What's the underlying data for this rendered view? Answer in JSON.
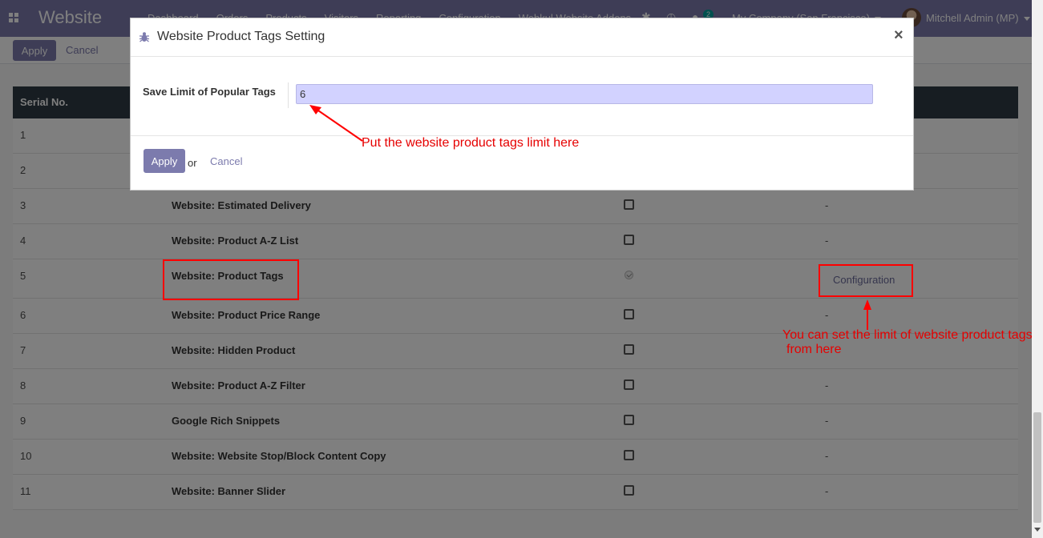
{
  "navbar": {
    "brand": "Website",
    "menu": [
      "Dashboard",
      "Orders",
      "Products",
      "Visitors",
      "Reporting",
      "Configuration",
      "Webkul Website Addons"
    ],
    "message_count": "2",
    "company": "My Company (San Francisco)",
    "user": "Mitchell Admin (MP)"
  },
  "control_panel": {
    "apply_label": "Apply",
    "cancel_label": "Cancel"
  },
  "table": {
    "header_serial": "Serial No.",
    "rows": [
      {
        "serial": "1",
        "name": "",
        "checked": false,
        "action": ""
      },
      {
        "serial": "2",
        "name": "",
        "checked": false,
        "action": ""
      },
      {
        "serial": "3",
        "name": "Website: Estimated Delivery",
        "checked": false,
        "action": "-"
      },
      {
        "serial": "4",
        "name": "Website: Product A-Z List",
        "checked": false,
        "action": "-"
      },
      {
        "serial": "5",
        "name": "Website: Product Tags",
        "checked": true,
        "action": "Configuration"
      },
      {
        "serial": "6",
        "name": "Website: Product Price Range",
        "checked": false,
        "action": "-"
      },
      {
        "serial": "7",
        "name": "Website: Hidden Product",
        "checked": false,
        "action": ""
      },
      {
        "serial": "8",
        "name": "Website: Product A-Z Filter",
        "checked": false,
        "action": "-"
      },
      {
        "serial": "9",
        "name": "Google Rich Snippets",
        "checked": false,
        "action": "-"
      },
      {
        "serial": "10",
        "name": "Website: Website Stop/Block Content Copy",
        "checked": false,
        "action": "-"
      },
      {
        "serial": "11",
        "name": "Website: Banner Slider",
        "checked": false,
        "action": "-"
      }
    ]
  },
  "modal": {
    "title": "Website Product Tags Setting",
    "close_label": "×",
    "field_label": "Save Limit of Popular Tags",
    "field_value": "6",
    "apply_label": "Apply",
    "or_label": "or",
    "cancel_label": "Cancel"
  },
  "annotations": {
    "input_note": "Put the website product tags limit here",
    "config_note_line1": "You can set the limit of website product tags",
    "config_note_line2": "from here",
    "color": "#ff0000"
  },
  "colors": {
    "brand": "#7c7bad",
    "table_header": "#2e3a44"
  }
}
